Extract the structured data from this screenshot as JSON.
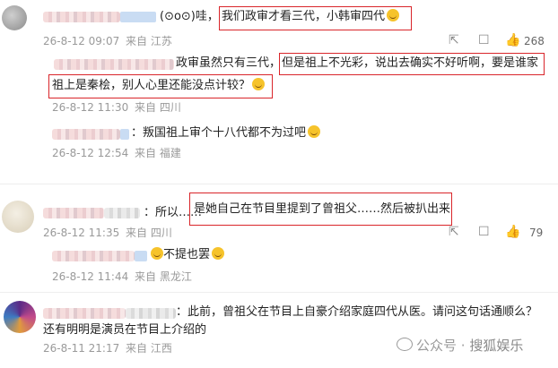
{
  "comments": [
    {
      "text_prefix": "(⊙o⊙)哇，",
      "text": "我们政审才看三代，小韩审四代",
      "time": "26-8-12 09:07",
      "from": "来自 江苏",
      "forward": "",
      "comment": "",
      "likes": "268"
    },
    {
      "text_1": "政审虽然只有三代，",
      "text_highlight_1": "但是祖上不光彩，说出去确实不好听啊，要是谁家",
      "text_highlight_2": "祖上是秦桧，别人心里还能没点计较？",
      "time": "26-8-12 11:30",
      "from": "来自 四川"
    },
    {
      "text": "：叛国祖上审个十八代都不为过吧",
      "time": "26-8-12 12:54",
      "from": "来自 福建"
    },
    {
      "text_prefix": "：所以……",
      "text_highlight": "是她自己在节目里提到了曾祖父……然后被扒出来",
      "time": "26-8-12 11:35",
      "from": "来自 四川",
      "likes": "79"
    },
    {
      "text": "不提也罢",
      "time": "26-8-12 11:44",
      "from": "来自 黑龙江"
    },
    {
      "text_1": "：此前，曾祖父在节目上自豪介绍家庭四代从医。请问这句话通顺么？",
      "text_2": "还有明明是演员在节目上介绍的",
      "time": "26-8-11 21:17",
      "from": "来自 江西"
    }
  ],
  "watermark": {
    "prefix": "公众号 · ",
    "name": "搜狐娱乐"
  },
  "icons": {
    "forward": "forward-icon",
    "comment": "comment-icon",
    "like": "thumbs-up-icon",
    "wechat": "wechat-icon"
  },
  "colors": {
    "highlight_box": "#d9252a",
    "meta": "#9a9a9a"
  }
}
